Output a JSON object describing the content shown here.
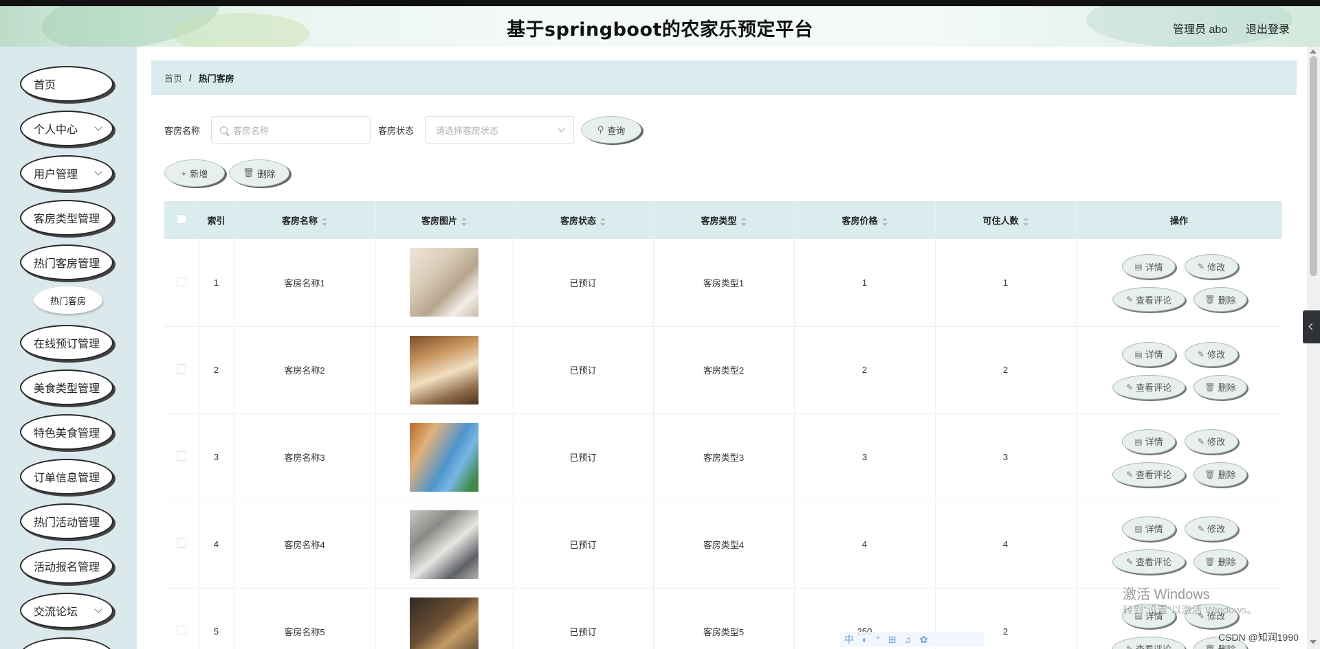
{
  "header": {
    "title": "基于springboot的农家乐预定平台",
    "admin_label": "管理员 abo",
    "logout": "退出登录"
  },
  "sidebar": {
    "items": [
      {
        "label": "首页",
        "has_arrow": false
      },
      {
        "label": "个人中心",
        "has_arrow": true
      },
      {
        "label": "用户管理",
        "has_arrow": true
      },
      {
        "label": "客房类型管理",
        "has_arrow": false
      },
      {
        "label": "热门客房管理",
        "has_arrow": false
      },
      {
        "label": "在线预订管理",
        "has_arrow": false
      },
      {
        "label": "美食类型管理",
        "has_arrow": false
      },
      {
        "label": "特色美食管理",
        "has_arrow": false
      },
      {
        "label": "订单信息管理",
        "has_arrow": false
      },
      {
        "label": "热门活动管理",
        "has_arrow": false
      },
      {
        "label": "活动报名管理",
        "has_arrow": false
      },
      {
        "label": "交流论坛",
        "has_arrow": true
      }
    ],
    "submenu": {
      "label": "热门客房"
    }
  },
  "breadcrumb": {
    "home": "首页",
    "separator": "/",
    "current": "热门客房"
  },
  "search": {
    "name_label": "客房名称",
    "name_placeholder": "客房名称",
    "status_label": "客房状态",
    "status_placeholder": "请选择客房状态",
    "query_button": "查询"
  },
  "toolbar": {
    "add_label": "新增",
    "delete_label": "删除"
  },
  "table": {
    "headers": {
      "index": "索引",
      "name": "客房名称",
      "image": "客房图片",
      "status": "客房状态",
      "type": "客房类型",
      "price": "客房价格",
      "capacity": "可住人数",
      "actions": "操作"
    },
    "rows": [
      {
        "index": "1",
        "name": "客房名称1",
        "status": "已预订",
        "type": "客房类型1",
        "price": "1",
        "capacity": "1"
      },
      {
        "index": "2",
        "name": "客房名称2",
        "status": "已预订",
        "type": "客房类型2",
        "price": "2",
        "capacity": "2"
      },
      {
        "index": "3",
        "name": "客房名称3",
        "status": "已预订",
        "type": "客房类型3",
        "price": "3",
        "capacity": "3"
      },
      {
        "index": "4",
        "name": "客房名称4",
        "status": "已预订",
        "type": "客房类型4",
        "price": "4",
        "capacity": "4"
      },
      {
        "index": "5",
        "name": "客房名称5",
        "status": "已预订",
        "type": "客房类型5",
        "price": "250",
        "capacity": "2"
      }
    ],
    "row_actions": {
      "detail": "详情",
      "edit": "修改",
      "comments": "查看评论",
      "delete": "删除"
    }
  },
  "watermark": {
    "activate_title": "激活 Windows",
    "activate_sub": "转到\"设置\"以激活 Windows。",
    "csdn": "CSDN @知润1990",
    "ime": "中 ◐ ° ⊞ ♫ ✿"
  },
  "icons": {
    "search": "search-icon",
    "plus": "plus-icon",
    "trash": "trash-icon",
    "doc": "document-icon",
    "pen": "edit-icon"
  },
  "colors": {
    "sidebar_bg": "#dbe9ec",
    "breadcrumb_bg": "#dbecee",
    "table_header_bg": "#dbecee"
  }
}
